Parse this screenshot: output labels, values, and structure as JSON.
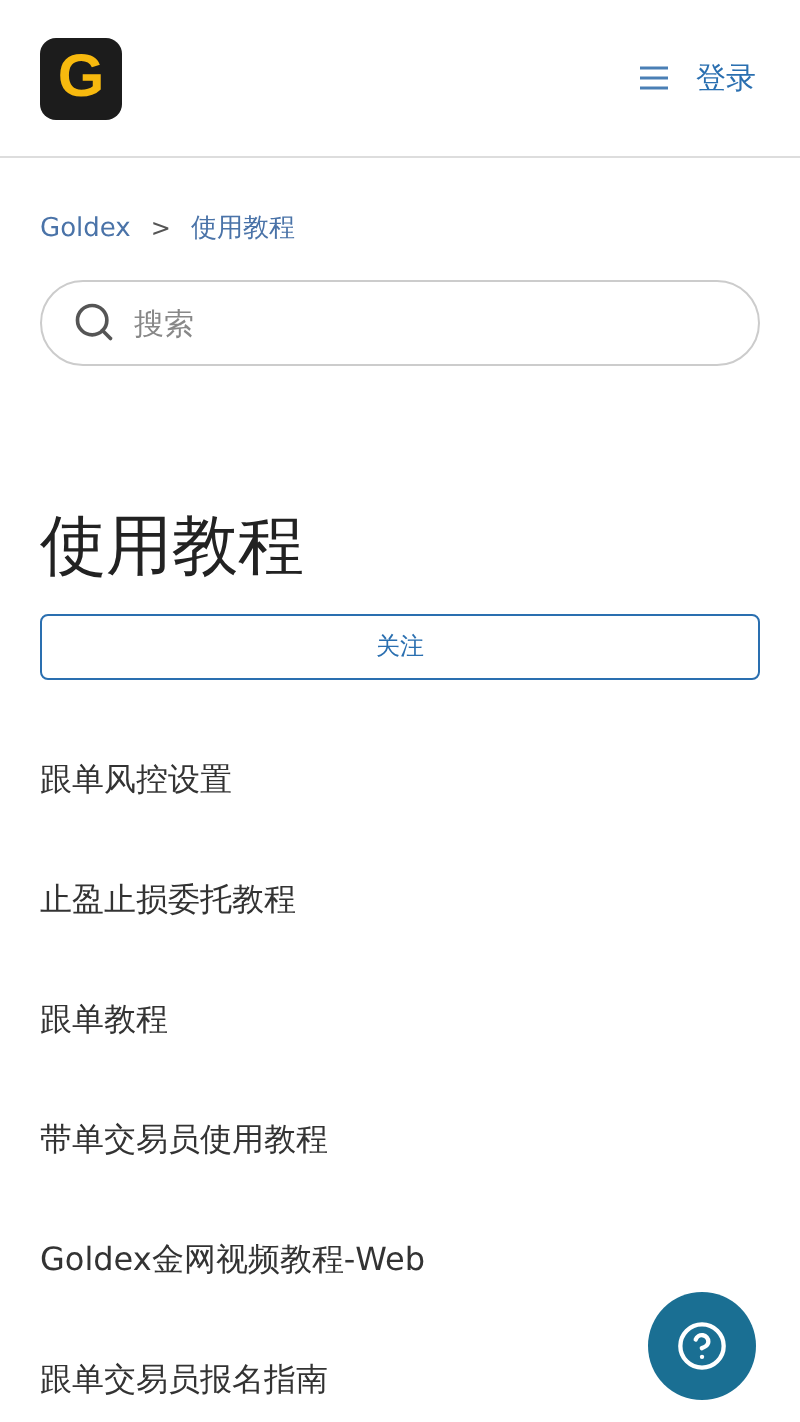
{
  "header": {
    "logo": "G",
    "login": "登录"
  },
  "breadcrumb": [
    {
      "label": "Goldex"
    },
    {
      "label": "使用教程"
    }
  ],
  "breadcrumb_separator": ">",
  "search": {
    "placeholder": "搜索"
  },
  "section": {
    "title": "使用教程",
    "follow_button": "关注"
  },
  "articles": [
    {
      "title": "跟单风控设置"
    },
    {
      "title": "止盈止损委托教程"
    },
    {
      "title": "跟单教程"
    },
    {
      "title": "带单交易员使用教程"
    },
    {
      "title": "Goldex金网视频教程-Web"
    },
    {
      "title": "跟单交易员报名指南"
    }
  ]
}
